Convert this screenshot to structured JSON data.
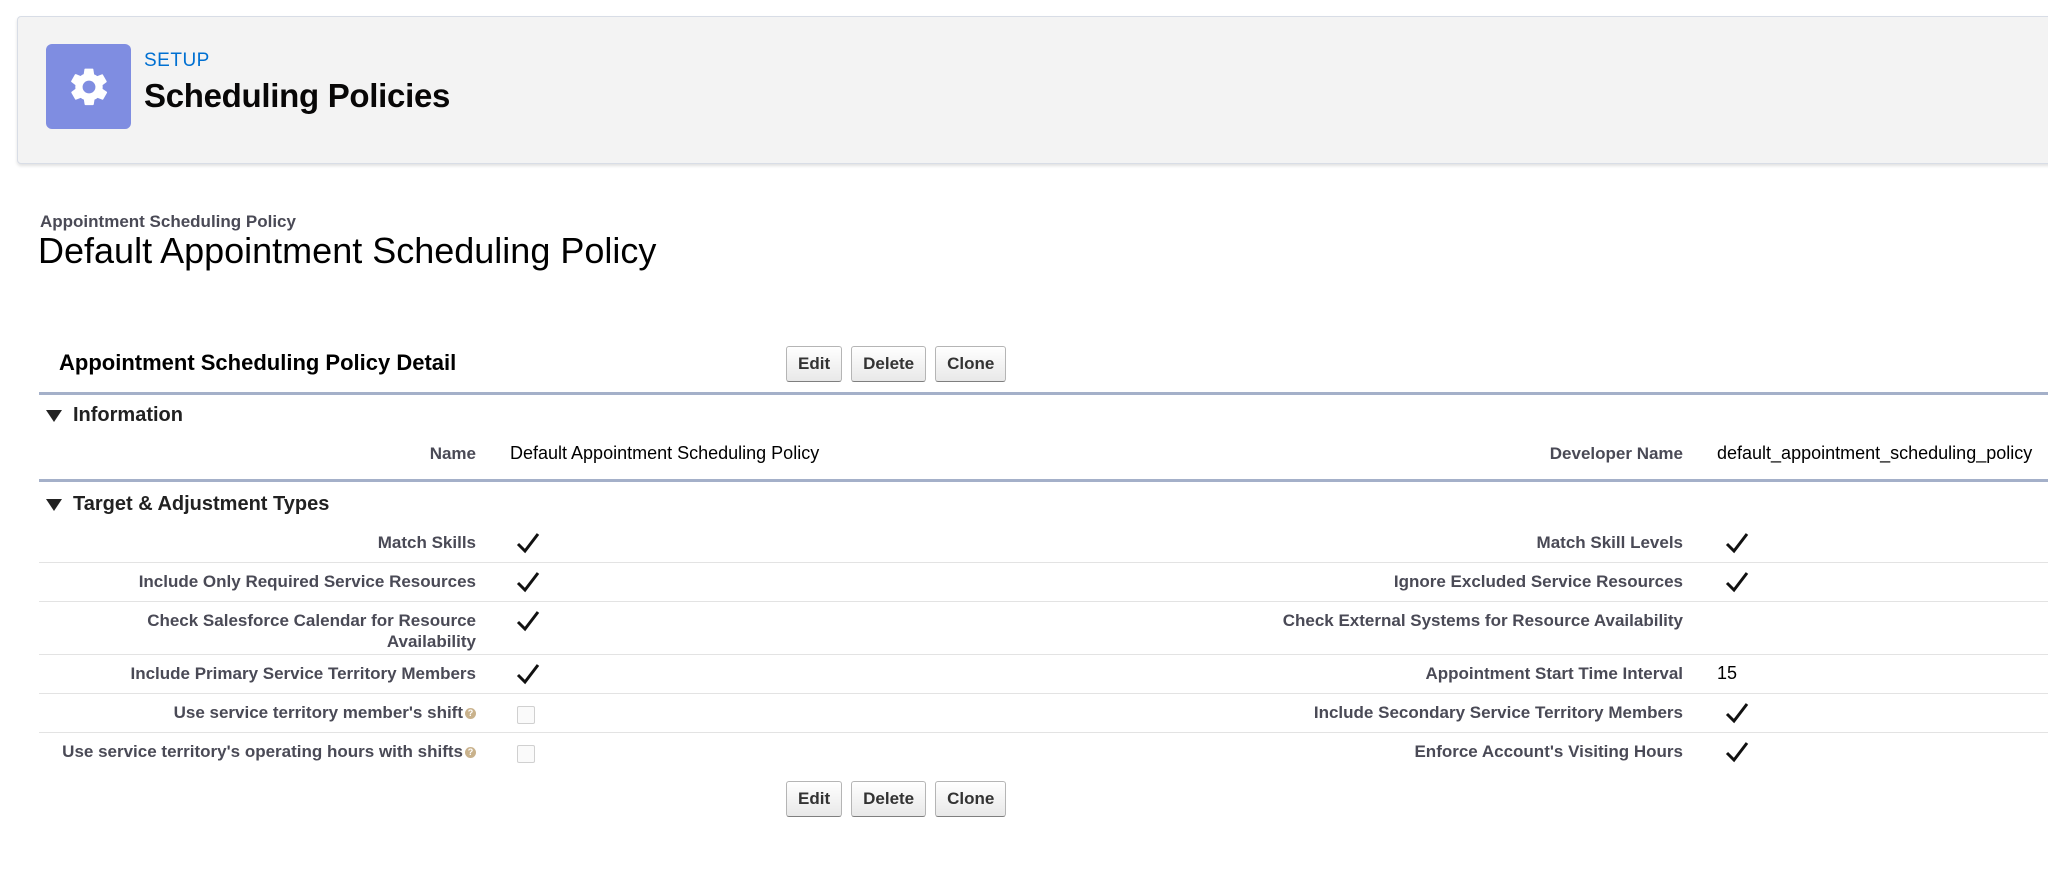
{
  "header": {
    "eyebrow": "SETUP",
    "title": "Scheduling Policies",
    "icon": "gear-icon",
    "icon_color": "#7f8de1"
  },
  "record": {
    "type_label": "Appointment Scheduling Policy",
    "name": "Default Appointment Scheduling Policy"
  },
  "detail": {
    "title": "Appointment Scheduling Policy Detail",
    "buttons": {
      "edit": "Edit",
      "delete": "Delete",
      "clone": "Clone"
    }
  },
  "information": {
    "title": "Information",
    "name_label": "Name",
    "name_value": "Default Appointment Scheduling Policy",
    "developer_name_label": "Developer Name",
    "developer_name_value": "default_appointment_scheduling_policy"
  },
  "targets": {
    "title": "Target & Adjustment Types",
    "rows": [
      {
        "left_label": "Match Skills",
        "left_checked": true,
        "right_label": "Match Skill Levels",
        "right_checked": true
      },
      {
        "left_label": "Include Only Required Service Resources",
        "left_checked": true,
        "right_label": "Ignore Excluded Service Resources",
        "right_checked": true
      },
      {
        "left_label_line1": "Check Salesforce Calendar for Resource",
        "left_label_line2": "Availability",
        "left_checked": true,
        "right_label": "Check External Systems for Resource Availability",
        "right_checked": false
      },
      {
        "left_label": "Include Primary Service Territory Members",
        "left_checked": true,
        "right_label": "Appointment Start Time Interval",
        "right_value": "15"
      },
      {
        "left_label": "Use service territory member's shift",
        "left_checked": false,
        "right_label": "Include Secondary Service Territory Members",
        "right_checked": true
      },
      {
        "left_label": "Use service territory's operating hours with shifts",
        "left_checked": false,
        "right_label": "Enforce Account's Visiting Hours",
        "right_checked": true
      }
    ]
  },
  "help_glyph": "?"
}
